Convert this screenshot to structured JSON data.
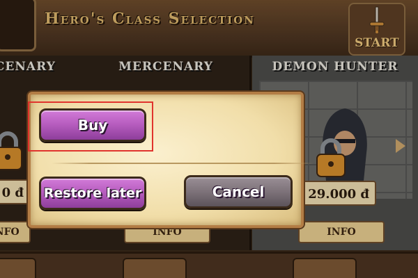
{
  "header": {
    "title": "Hero's Class Selection",
    "start_label": "START"
  },
  "heroes": [
    {
      "name": "MERCENARY",
      "price": "0 đ",
      "info_label": "INFO",
      "locked": true
    },
    {
      "name": "MERCENARY",
      "info_label": "INFO",
      "locked": false
    },
    {
      "name": "DEMON HUNTER",
      "price": "29.000 đ",
      "info_label": "INFO",
      "locked": true
    }
  ],
  "dialog": {
    "buy_label": "Buy",
    "restore_label": "Restore later",
    "cancel_label": "Cancel"
  },
  "colors": {
    "accent_purple": "#b85ec0",
    "cancel_gray": "#7d7279",
    "highlight_red": "#e0332d",
    "dialog_bg": "#f1dea9"
  }
}
